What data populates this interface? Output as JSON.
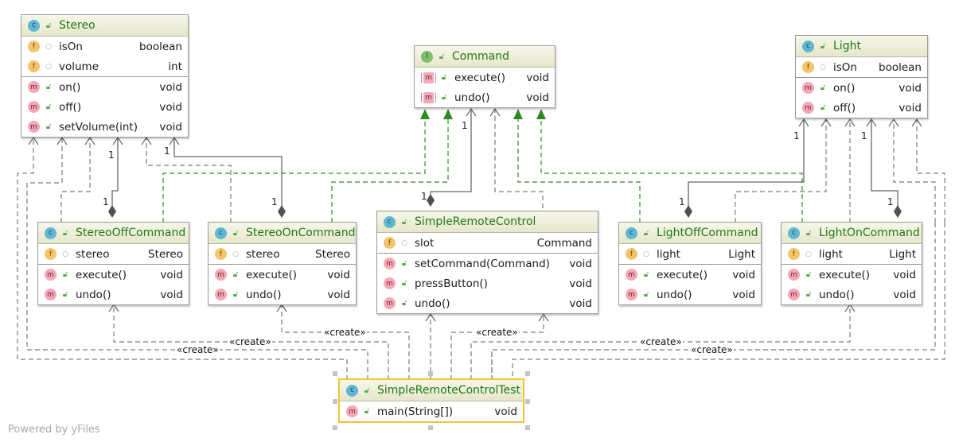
{
  "diagram": {
    "watermark": "Powered by yFiles",
    "colors": {
      "header_text": "#1f7a12",
      "realization": "#2e8b1f",
      "dependency": "#777777",
      "association": "#555555",
      "selection": "#f5c531"
    },
    "classes": {
      "stereo": {
        "kind": "class",
        "kind_badge": "c",
        "title": "Stereo",
        "fields": [
          {
            "badge": "f",
            "name": "isOn",
            "type": "boolean"
          },
          {
            "badge": "f",
            "name": "volume",
            "type": "int"
          }
        ],
        "methods": [
          {
            "badge": "m",
            "name": "on()",
            "type": "void"
          },
          {
            "badge": "m",
            "name": "off()",
            "type": "void"
          },
          {
            "badge": "m",
            "name": "setVolume(int)",
            "type": "void"
          }
        ]
      },
      "command": {
        "kind": "interface",
        "kind_badge": "I",
        "title": "Command",
        "methods": [
          {
            "badge": "m",
            "name": "execute()",
            "type": "void"
          },
          {
            "badge": "m",
            "name": "undo()",
            "type": "void"
          }
        ]
      },
      "light": {
        "kind": "class",
        "kind_badge": "c",
        "title": "Light",
        "fields": [
          {
            "badge": "f",
            "name": "isOn",
            "type": "boolean"
          }
        ],
        "methods": [
          {
            "badge": "m",
            "name": "on()",
            "type": "void"
          },
          {
            "badge": "m",
            "name": "off()",
            "type": "void"
          }
        ]
      },
      "stereo_off": {
        "kind": "class",
        "kind_badge": "c",
        "title": "StereoOffCommand",
        "fields": [
          {
            "badge": "f",
            "name": "stereo",
            "type": "Stereo"
          }
        ],
        "methods": [
          {
            "badge": "m",
            "name": "execute()",
            "type": "void"
          },
          {
            "badge": "m",
            "name": "undo()",
            "type": "void"
          }
        ]
      },
      "stereo_on": {
        "kind": "class",
        "kind_badge": "c",
        "title": "StereoOnCommand",
        "fields": [
          {
            "badge": "f",
            "name": "stereo",
            "type": "Stereo"
          }
        ],
        "methods": [
          {
            "badge": "m",
            "name": "execute()",
            "type": "void"
          },
          {
            "badge": "m",
            "name": "undo()",
            "type": "void"
          }
        ]
      },
      "remote": {
        "kind": "class",
        "kind_badge": "c",
        "title": "SimpleRemoteControl",
        "fields": [
          {
            "badge": "f",
            "name": "slot",
            "type": "Command"
          }
        ],
        "methods": [
          {
            "badge": "m",
            "name": "setCommand(Command)",
            "type": "void"
          },
          {
            "badge": "m",
            "name": "pressButton()",
            "type": "void"
          },
          {
            "badge": "m",
            "name": "undo()",
            "type": "void"
          }
        ]
      },
      "light_off": {
        "kind": "class",
        "kind_badge": "c",
        "title": "LightOffCommand",
        "fields": [
          {
            "badge": "f",
            "name": "light",
            "type": "Light"
          }
        ],
        "methods": [
          {
            "badge": "m",
            "name": "execute()",
            "type": "void"
          },
          {
            "badge": "m",
            "name": "undo()",
            "type": "void"
          }
        ]
      },
      "light_on": {
        "kind": "class",
        "kind_badge": "c",
        "title": "LightOnCommand",
        "fields": [
          {
            "badge": "f",
            "name": "light",
            "type": "Light"
          }
        ],
        "methods": [
          {
            "badge": "m",
            "name": "execute()",
            "type": "void"
          },
          {
            "badge": "m",
            "name": "undo()",
            "type": "void"
          }
        ]
      },
      "test": {
        "kind": "class",
        "kind_badge": "c",
        "title": "SimpleRemoteControlTest",
        "selected": true,
        "methods": [
          {
            "badge": "m",
            "name": "main(String[])",
            "type": "void"
          }
        ]
      }
    },
    "edge_labels": {
      "multiplicity": "1",
      "create": "«create»"
    }
  }
}
